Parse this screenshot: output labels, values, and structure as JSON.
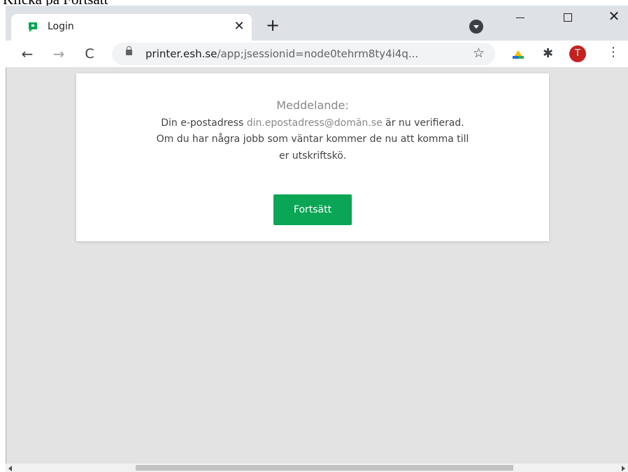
{
  "caption": "Klicka på Fortsätt",
  "browser": {
    "tab_title": "Login",
    "tab_close": "✕",
    "new_tab": "+",
    "url_host": "printer.esh.se",
    "url_path": "/app;jsessionid=node0tehrm8ty4i4q...",
    "avatar_initial": "T",
    "colors": {
      "avatar": "#c5221f",
      "favicon": "#0aa656"
    }
  },
  "dialog": {
    "heading": "Meddelande:",
    "line1_prefix": "Din e-postadress",
    "email": "din.epostadress@domän.se",
    "line1_suffix": "är nu verifierad.",
    "line2": "Om du har några jobb som väntar kommer de nu att komma till",
    "line3": "er utskriftskö.",
    "continue_label": "Fortsätt",
    "colors": {
      "button": "#0aa656"
    }
  }
}
